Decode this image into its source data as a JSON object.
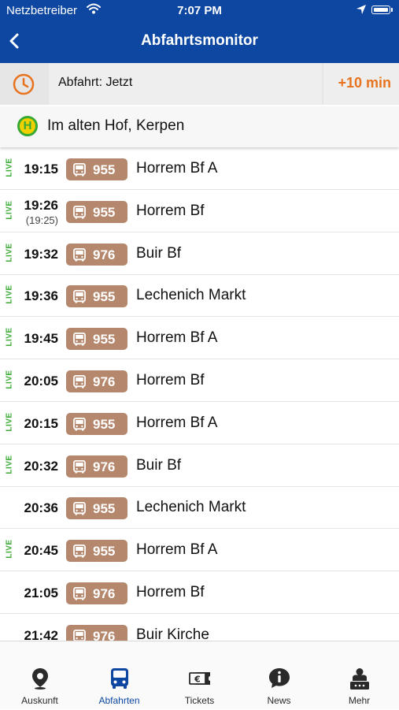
{
  "status": {
    "carrier": "Netzbetreiber",
    "time": "7:07 PM"
  },
  "nav": {
    "title": "Abfahrtsmonitor"
  },
  "time_selector": {
    "departure": "Abfahrt: Jetzt",
    "plus": "+10 min"
  },
  "station": {
    "name": "Im alten Hof, Kerpen",
    "icon_letter": "H"
  },
  "live_label": "LIVE",
  "departures": [
    {
      "time": "19:15",
      "scheduled": "",
      "live": true,
      "line": "955",
      "destination": "Horrem Bf A"
    },
    {
      "time": "19:26",
      "scheduled": "(19:25)",
      "live": true,
      "line": "955",
      "destination": "Horrem Bf"
    },
    {
      "time": "19:32",
      "scheduled": "",
      "live": true,
      "line": "976",
      "destination": "Buir Bf"
    },
    {
      "time": "19:36",
      "scheduled": "",
      "live": true,
      "line": "955",
      "destination": "Lechenich Markt"
    },
    {
      "time": "19:45",
      "scheduled": "",
      "live": true,
      "line": "955",
      "destination": "Horrem Bf A"
    },
    {
      "time": "20:05",
      "scheduled": "",
      "live": true,
      "line": "976",
      "destination": "Horrem Bf"
    },
    {
      "time": "20:15",
      "scheduled": "",
      "live": true,
      "line": "955",
      "destination": "Horrem Bf A"
    },
    {
      "time": "20:32",
      "scheduled": "",
      "live": true,
      "line": "976",
      "destination": "Buir Bf"
    },
    {
      "time": "20:36",
      "scheduled": "",
      "live": false,
      "line": "955",
      "destination": "Lechenich Markt"
    },
    {
      "time": "20:45",
      "scheduled": "",
      "live": true,
      "line": "955",
      "destination": "Horrem Bf A"
    },
    {
      "time": "21:05",
      "scheduled": "",
      "live": false,
      "line": "976",
      "destination": "Horrem Bf"
    },
    {
      "time": "21:42",
      "scheduled": "",
      "live": false,
      "line": "976",
      "destination": "Buir Kirche"
    }
  ],
  "tabs": [
    {
      "label": "Auskunft",
      "icon": "location-pin-icon",
      "active": false
    },
    {
      "label": "Abfahrten",
      "icon": "bus-icon",
      "active": true
    },
    {
      "label": "Tickets",
      "icon": "ticket-icon",
      "active": false
    },
    {
      "label": "News",
      "icon": "news-bubble-icon",
      "active": false
    },
    {
      "label": "Mehr",
      "icon": "person-more-icon",
      "active": false
    }
  ],
  "colors": {
    "nav_bg": "#0d47a1",
    "accent_orange": "#e8731e",
    "badge_bg": "#b5886e",
    "live_green": "#3aaa35",
    "tab_active": "#0d47a1"
  }
}
